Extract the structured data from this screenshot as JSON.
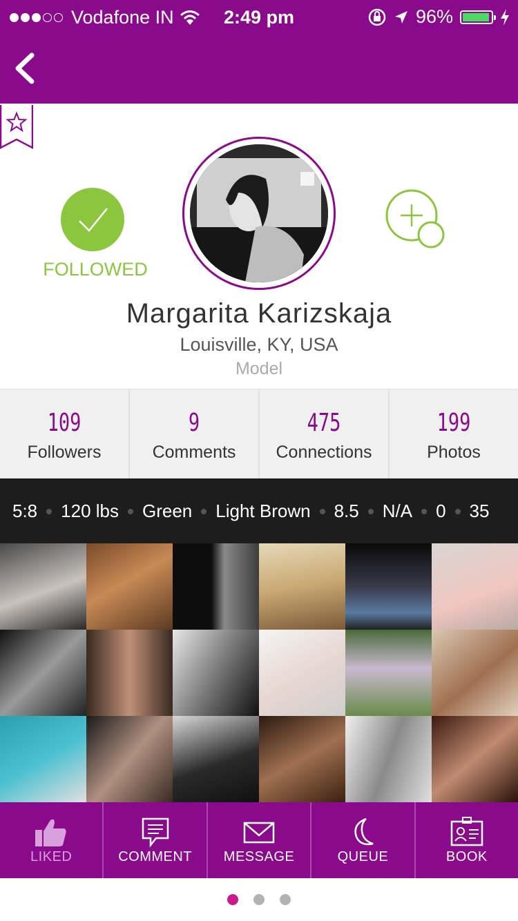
{
  "status_bar": {
    "carrier": "Vodafone IN",
    "time": "2:49 pm",
    "battery": "96%",
    "battery_level": 0.96
  },
  "profile": {
    "follow_label": "FOLLOWED",
    "name": "Margarita  Karizskaja",
    "location": "Louisville, KY, USA",
    "role": "Model"
  },
  "stats": [
    {
      "value": "109",
      "label": "Followers"
    },
    {
      "value": "9",
      "label": "Comments"
    },
    {
      "value": "475",
      "label": "Connections"
    },
    {
      "value": "199",
      "label": "Photos"
    }
  ],
  "attributes": [
    "5:8",
    "120 lbs",
    "Green",
    "Light Brown",
    "8.5",
    "N/A",
    "0",
    "35"
  ],
  "actions": [
    {
      "label": "LIKED",
      "icon": "thumbs-up-icon"
    },
    {
      "label": "COMMENT",
      "icon": "comment-icon"
    },
    {
      "label": "MESSAGE",
      "icon": "envelope-icon"
    },
    {
      "label": "QUEUE",
      "icon": "moon-icon"
    },
    {
      "label": "BOOK",
      "icon": "id-card-icon"
    }
  ],
  "pager": {
    "count": 3,
    "active": 0
  },
  "colors": {
    "brand": "#8a0a8c",
    "follow": "#8cc63f",
    "active_dot": "#cc1a8c"
  }
}
